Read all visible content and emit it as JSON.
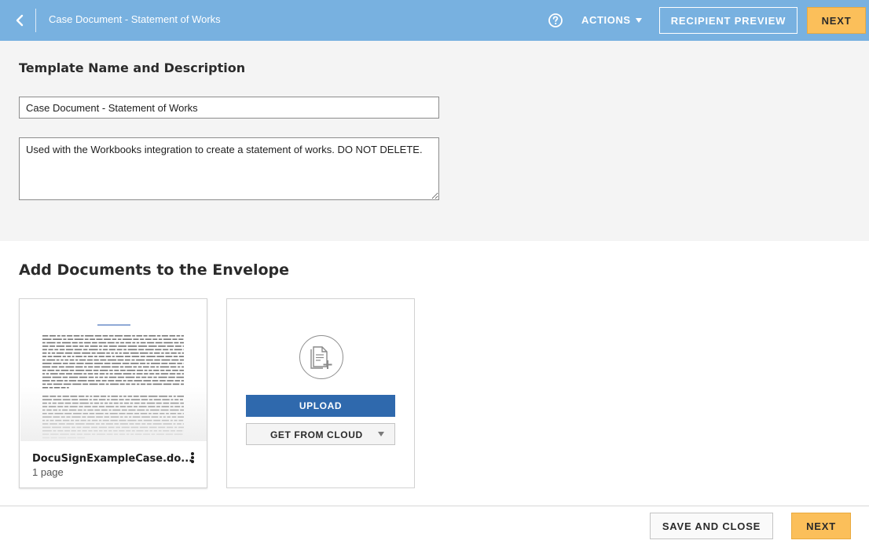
{
  "header": {
    "doc_title": "Case Document - Statement of Works",
    "actions_label": "ACTIONS",
    "recipient_preview_label": "RECIPIENT PREVIEW",
    "next_label": "NEXT",
    "icons": {
      "back": "chevron-left-icon",
      "help": "question-circle-icon",
      "actions_caret": "caret-down-icon"
    },
    "colors": {
      "bar": "#78b1e0",
      "accent": "#fbbf5a"
    }
  },
  "template": {
    "heading": "Template Name and Description",
    "name_value": "Case Document - Statement of Works",
    "description_value": "Used with the Workbooks integration to create a statement of works. DO NOT DELETE."
  },
  "documents": {
    "heading": "Add Documents to the Envelope",
    "items": [
      {
        "name": "DocuSignExampleCase.do...",
        "pages": "1 page",
        "menu_icon": "kebab-menu-icon"
      }
    ],
    "upload": {
      "icon": "add-document-icon",
      "upload_label": "UPLOAD",
      "cloud_label": "GET FROM CLOUD",
      "cloud_caret": "caret-down-icon",
      "colors": {
        "upload_button": "#2f69ad"
      }
    }
  },
  "footer": {
    "save_close_label": "SAVE AND CLOSE",
    "next_label": "NEXT"
  }
}
